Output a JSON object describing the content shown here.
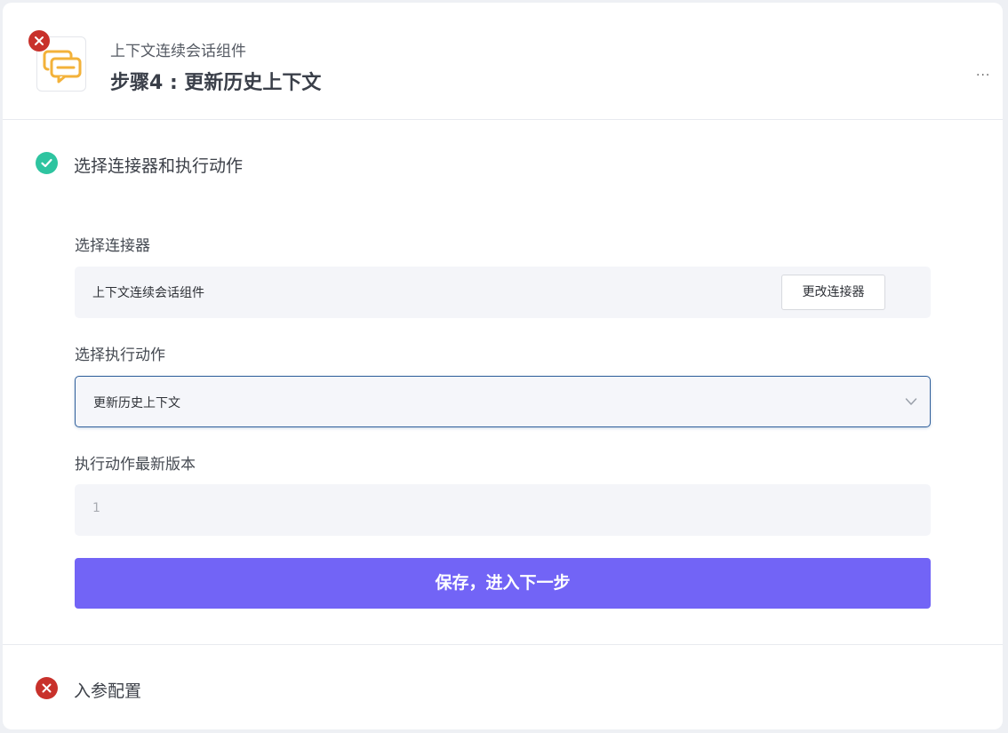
{
  "header": {
    "connector_name": "上下文连续会话组件",
    "step_title": "步骤4 : 更新历史上下文",
    "more_label": "···",
    "icon": "chat-bubbles-icon",
    "status_icon": "error-icon"
  },
  "section_connector": {
    "title": "选择连接器和执行动作",
    "status": "success",
    "status_color": "#2ec4a0",
    "connector_label": "选择连接器",
    "connector_value": "上下文连续会话组件",
    "change_button": "更改连接器",
    "action_label": "选择执行动作",
    "action_value": "更新历史上下文",
    "version_label": "执行动作最新版本",
    "version_value": "1",
    "save_button": "保存，进入下一步"
  },
  "section_params": {
    "title": "入参配置",
    "status": "error",
    "status_color": "#c8312b"
  },
  "colors": {
    "primary": "#7264f6",
    "success": "#2ec4a0",
    "error": "#c8312b",
    "icon_accent": "#f3b23a"
  }
}
